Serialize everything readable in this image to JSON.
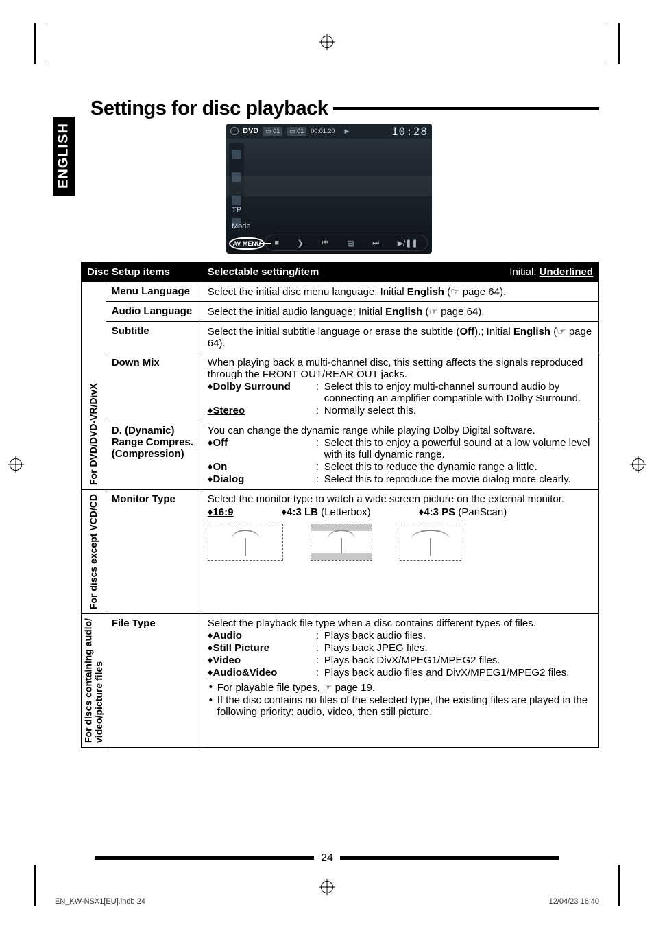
{
  "side_tab": "ENGLISH",
  "heading": "Settings for disc playback",
  "screenshot": {
    "source_label": "DVD",
    "chapter_badge": "01",
    "title_badge": "01",
    "elapsed": "00:01:20",
    "clock": "10:28",
    "tp": "TP",
    "mode": "Mode",
    "av_menu": "AV MENU"
  },
  "table": {
    "h1": "Disc Setup items",
    "h2": "Selectable setting/item",
    "h3_prefix": "Initial: ",
    "h3_value": "Underlined",
    "cat1": "For DVD/DVD-VR/DivX",
    "cat2": "For discs except VCD/CD",
    "cat3": "For discs containing audio/\nvideo/picture files",
    "menu_lang": {
      "name": "Menu Language",
      "desc_a": "Select the initial disc menu language; Initial ",
      "val": "English",
      "desc_b": " (☞ page 64)."
    },
    "audio_lang": {
      "name": "Audio Language",
      "desc_a": "Select the initial audio language; Initial ",
      "val": "English",
      "desc_b": " (☞ page 64)."
    },
    "subtitle": {
      "name": "Subtitle",
      "desc_a": "Select the initial subtitle language or erase the subtitle (",
      "off": "Off",
      "desc_b": ").; Initial ",
      "val": "English",
      "desc_c": " (☞ page 64)."
    },
    "downmix": {
      "name": "Down Mix",
      "intro": "When playing back a multi-channel disc, this setting affects the signals reproduced through the FRONT OUT/REAR OUT jacks.",
      "o1": "Dolby Surround",
      "o1d": "Select this to enjoy multi-channel surround audio by connecting an amplifier compatible with Dolby Surround.",
      "o2": "Stereo",
      "o2d": "Normally select this."
    },
    "drc": {
      "name1": "D. (Dynamic)",
      "name2": "Range Compres.",
      "name3": "(Compression)",
      "intro": "You can change the dynamic range while playing Dolby Digital software.",
      "o1": "Off",
      "o1d": "Select this to enjoy a powerful sound at a low volume level with its full dynamic range.",
      "o2": "On",
      "o2d": "Select this to reduce the dynamic range a little.",
      "o3": "Dialog",
      "o3d": "Select this to reproduce the movie dialog more clearly."
    },
    "monitor": {
      "name": "Monitor Type",
      "intro": "Select the monitor type to watch a wide screen picture on the external monitor.",
      "o1": "16:9",
      "o2": "4:3 LB",
      "o2s": " (Letterbox)",
      "o3": "4:3 PS",
      "o3s": " (PanScan)"
    },
    "filetype": {
      "name": "File Type",
      "intro": "Select the playback file type when a disc contains different types of files.",
      "o1": "Audio",
      "o1d": "Plays back audio files.",
      "o2": "Still Picture",
      "o2d": "Plays back JPEG files.",
      "o3": "Video",
      "o3d": "Plays back DivX/MPEG1/MPEG2 files.",
      "o4": "Audio&Video",
      "o4d": "Plays back audio files and DivX/MPEG1/MPEG2 files.",
      "n1": "For playable file types, ☞ page 19.",
      "n2": "If the disc contains no files of the selected type, the existing files are played in the following priority: audio, video, then still picture."
    }
  },
  "page_number": "24",
  "footer_left": "EN_KW-NSX1[EU].indb   24",
  "footer_right": "12/04/23   16:40"
}
